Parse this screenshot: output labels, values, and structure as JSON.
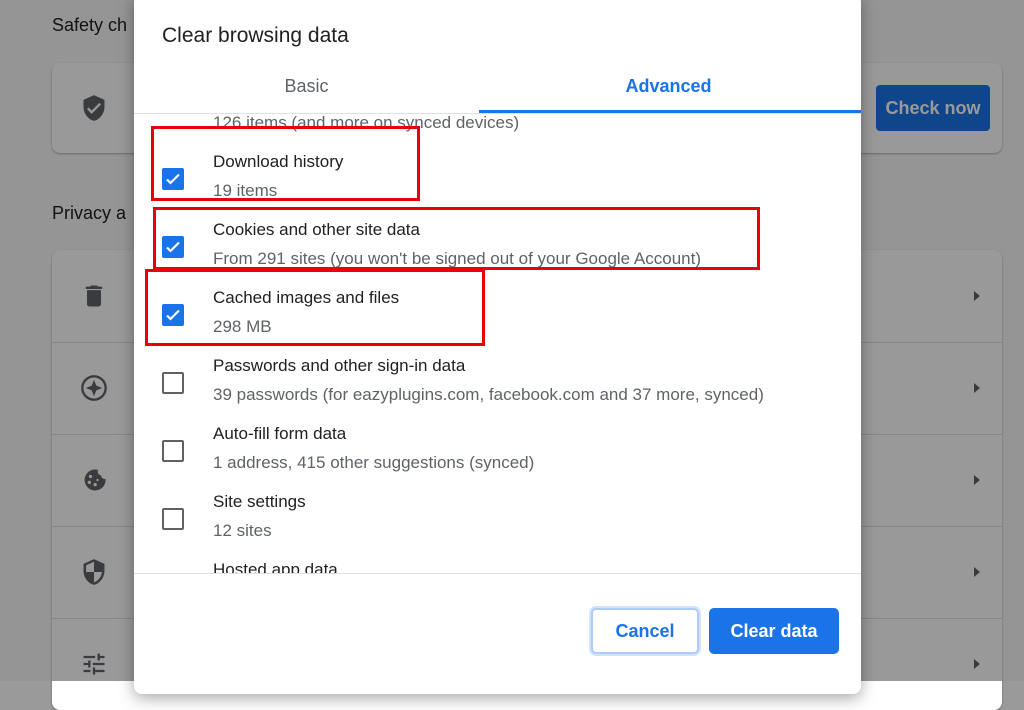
{
  "background": {
    "section_safety": "Safety ch",
    "section_privacy": "Privacy a",
    "check_now_label": "Check now"
  },
  "dialog": {
    "title": "Clear browsing data",
    "tabs": [
      {
        "label": "Basic",
        "selected": false
      },
      {
        "label": "Advanced",
        "selected": true
      }
    ],
    "items": [
      {
        "label": "",
        "detail": "126 items (and more on synced devices)",
        "checked": true
      },
      {
        "label": "Download history",
        "detail": "19 items",
        "checked": true
      },
      {
        "label": "Cookies and other site data",
        "detail": "From 291 sites (you won't be signed out of your Google Account)",
        "checked": true
      },
      {
        "label": "Cached images and files",
        "detail": "298 MB",
        "checked": true
      },
      {
        "label": "Passwords and other sign-in data",
        "detail": "39 passwords (for eazyplugins.com, facebook.com and 37 more, synced)",
        "checked": false
      },
      {
        "label": "Auto-fill form data",
        "detail": "1 address, 415 other suggestions (synced)",
        "checked": false
      },
      {
        "label": "Site settings",
        "detail": "12 sites",
        "checked": false
      },
      {
        "label": "Hosted app data",
        "detail": "",
        "checked": false
      }
    ],
    "cancel_label": "Cancel",
    "clear_label": "Clear data"
  },
  "colors": {
    "accent": "#1a73e8",
    "highlight": "#e8000b"
  }
}
